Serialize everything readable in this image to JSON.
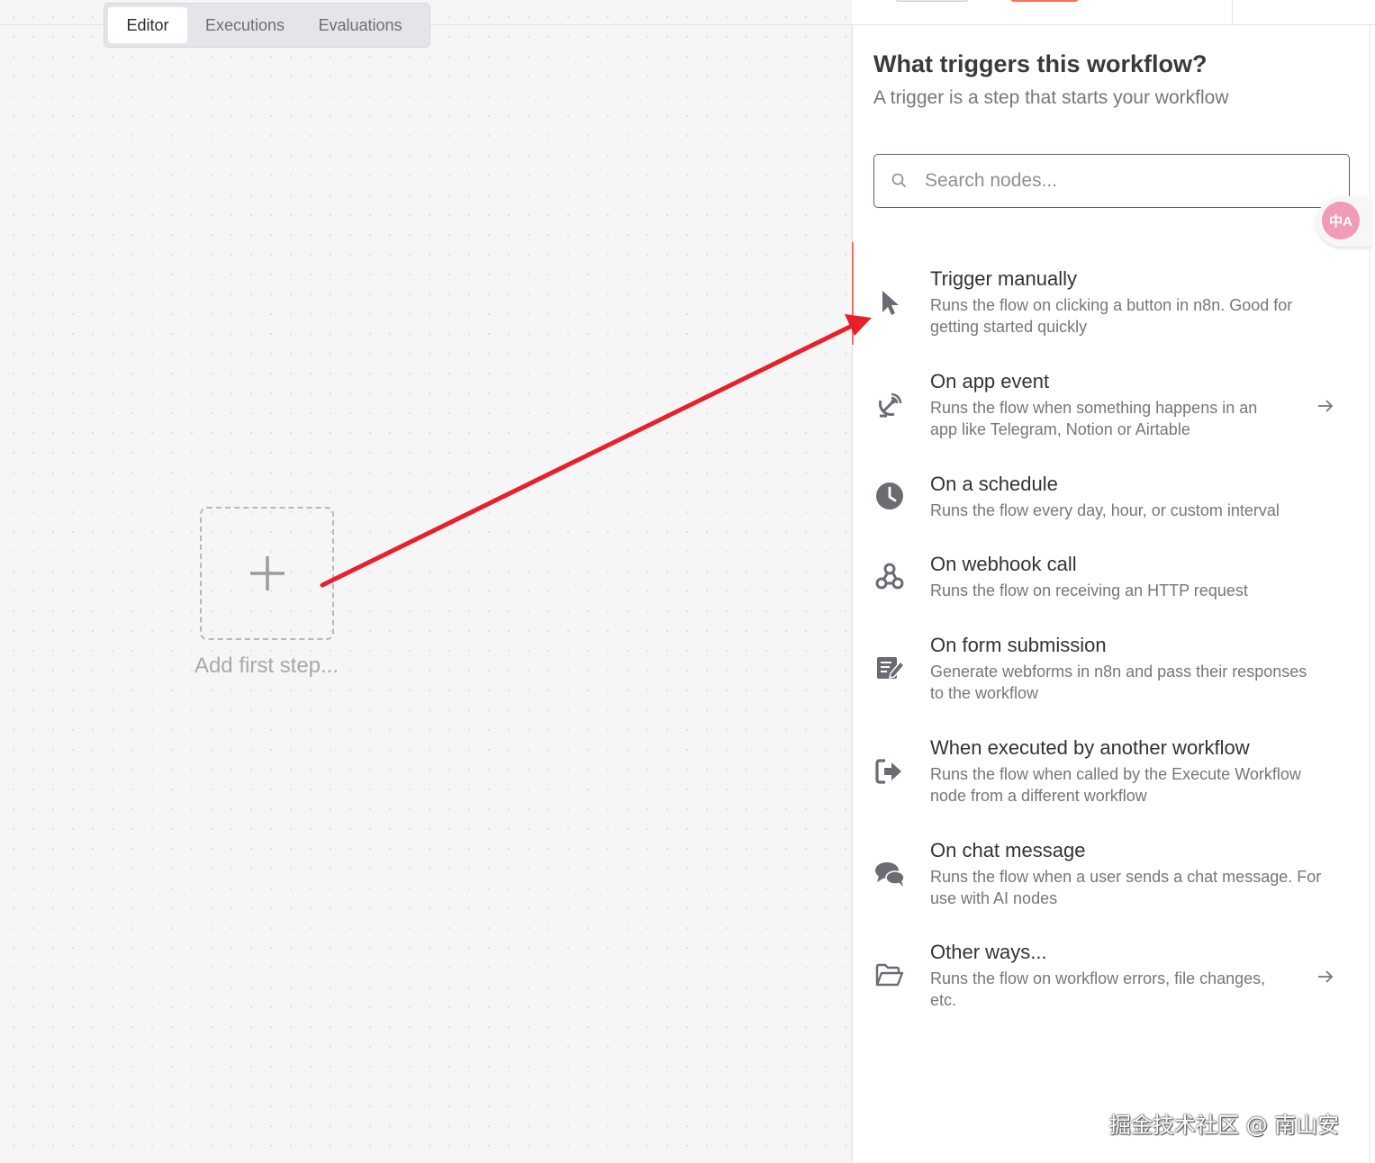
{
  "tabs": [
    {
      "label": "Editor",
      "active": true
    },
    {
      "label": "Executions",
      "active": false
    },
    {
      "label": "Evaluations",
      "active": false
    }
  ],
  "canvas": {
    "add_step_label": "Add first step..."
  },
  "panel": {
    "title": "What triggers this workflow?",
    "subtitle": "A trigger is a step that starts your workflow",
    "search_placeholder": "Search nodes...",
    "translate_badge": "中A",
    "items": [
      {
        "title": "Trigger manually",
        "desc_lines": [
          "Runs the flow on clicking a button in n8n. Good for",
          "getting started quickly"
        ],
        "icon": "cursor-icon",
        "has_chevron": false
      },
      {
        "title": "On app event",
        "desc_lines": [
          "Runs the flow when something happens in an",
          "app like Telegram, Notion or Airtable"
        ],
        "icon": "satellite-dish-icon",
        "has_chevron": true
      },
      {
        "title": "On a schedule",
        "desc_lines": [
          "Runs the flow every day, hour, or custom interval"
        ],
        "icon": "clock-icon",
        "has_chevron": false
      },
      {
        "title": "On webhook call",
        "desc_lines": [
          "Runs the flow on receiving an HTTP request"
        ],
        "icon": "webhook-icon",
        "has_chevron": false
      },
      {
        "title": "On form submission",
        "desc_lines": [
          "Generate webforms in n8n and pass their responses",
          "to the workflow"
        ],
        "icon": "form-edit-icon",
        "has_chevron": false
      },
      {
        "title": "When executed by another workflow",
        "desc_lines": [
          "Runs the flow when called by the Execute Workflow",
          "node from a different workflow"
        ],
        "icon": "sign-in-icon",
        "has_chevron": false
      },
      {
        "title": "On chat message",
        "desc_lines": [
          "Runs the flow when a user sends a chat message. For",
          "use with AI nodes"
        ],
        "icon": "chat-bubbles-icon",
        "has_chevron": false
      },
      {
        "title": "Other ways...",
        "desc_lines": [
          "Runs the flow on workflow errors, file changes,",
          "etc."
        ],
        "icon": "folder-open-icon",
        "has_chevron": true
      }
    ]
  },
  "watermark": "掘金技术社区 @ 南山安",
  "colors": {
    "accent": "#ff6d5a",
    "annotation_arrow": "#e8202a",
    "search_border": "#5d5d8a"
  }
}
